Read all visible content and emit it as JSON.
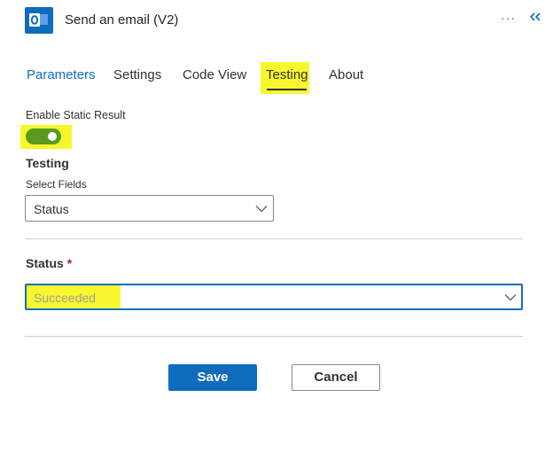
{
  "header": {
    "title": "Send an email (V2)",
    "app_icon": "outlook-icon",
    "more_label": "···",
    "collapse_icon": "double-chevron-left-icon",
    "accent": "#0f6cbd"
  },
  "tabs": [
    {
      "label": "Parameters"
    },
    {
      "label": "Settings"
    },
    {
      "label": "Code View"
    },
    {
      "label": "Testing"
    },
    {
      "label": "About"
    }
  ],
  "static_result": {
    "label": "Enable Static Result",
    "enabled": true,
    "toggle_color": "#5a9b1d"
  },
  "testing": {
    "title": "Testing",
    "select_fields_label": "Select Fields",
    "select_fields_value": "Status"
  },
  "status": {
    "label": "Status",
    "required_mark": "*",
    "value": "Succeeded"
  },
  "buttons": {
    "save": "Save",
    "cancel": "Cancel"
  },
  "highlight_color": "#f7f72d"
}
